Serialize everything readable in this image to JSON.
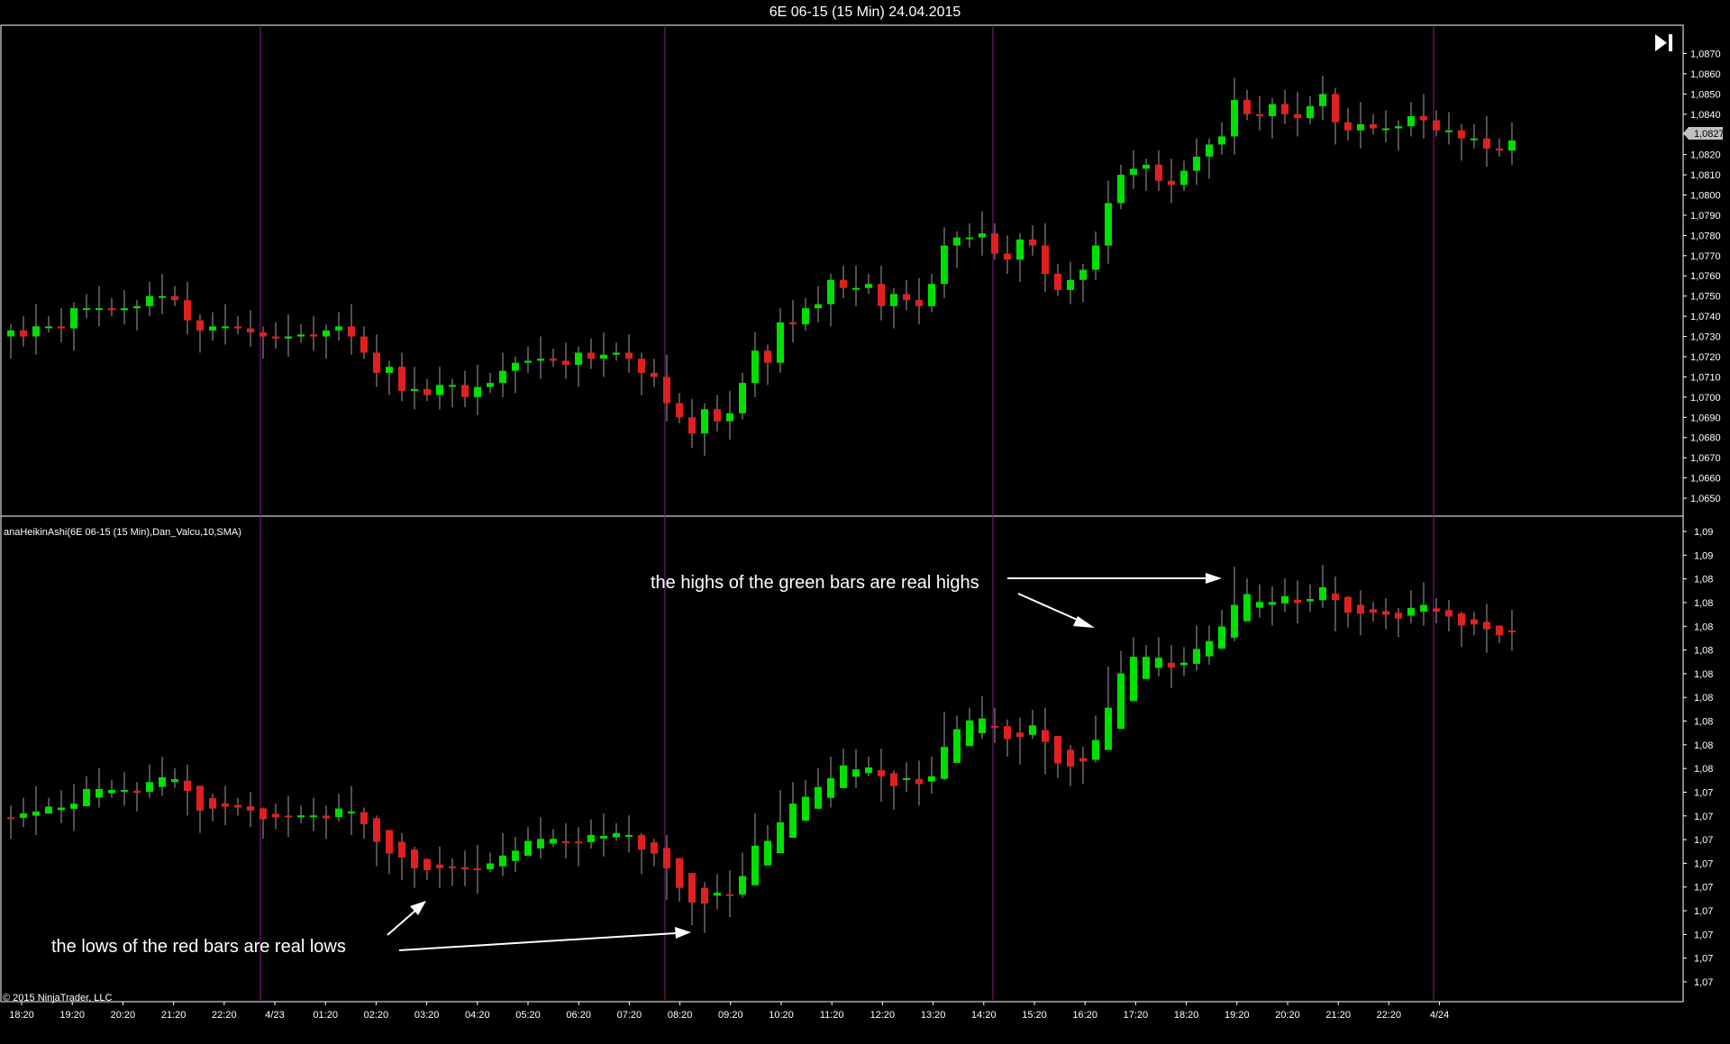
{
  "window": {
    "title": "6E 06-15 (15 Min)  24.04.2015"
  },
  "indicator_label": "anaHeikinAshi(6E 06-15 (15 Min),Dan_Valcu,10,SMA)",
  "copyright": "© 2015 NinjaTrader, LLC",
  "price_marker": "1,0827",
  "annotations": {
    "highs": "the highs of the green bars are real highs",
    "lows": "the lows of the red bars are real lows"
  },
  "colors": {
    "up": "#00e000",
    "down": "#e02020",
    "wick": "#a0a0a0",
    "session_line": "#8b1a8b",
    "background": "#000000",
    "frame": "#ffffff"
  },
  "chart_data": [
    {
      "type": "candlestick",
      "panel": "price",
      "y_ticks": [
        "1,0870",
        "1,0860",
        "1,0850",
        "1,0840",
        "1,0830",
        "1,0820",
        "1,0810",
        "1,0800",
        "1,0790",
        "1,0780",
        "1,0770",
        "1,0760",
        "1,0750",
        "1,0740",
        "1,0730",
        "1,0720",
        "1,0710",
        "1,0700",
        "1,0690",
        "1,0680",
        "1,0670",
        "1,0660",
        "1,0650"
      ],
      "ylim": [
        1.0646,
        1.0876
      ],
      "bar_count": 120,
      "path": [
        1.0733,
        1.073,
        1.0735,
        1.0735,
        1.0734,
        1.0744,
        1.0744,
        1.0744,
        1.0743,
        1.0744,
        1.0745,
        1.075,
        1.075,
        1.0748,
        1.0738,
        1.0733,
        1.0735,
        1.0735,
        1.0734,
        1.0732,
        1.073,
        1.0729,
        1.073,
        1.0731,
        1.073,
        1.0733,
        1.0735,
        1.073,
        1.0722,
        1.0712,
        1.0715,
        1.0703,
        1.0704,
        1.0701,
        1.0706,
        1.0706,
        1.07,
        1.0705,
        1.0707,
        1.0713,
        1.0717,
        1.0718,
        1.0719,
        1.0718,
        1.0716,
        1.0722,
        1.0719,
        1.0721,
        1.0722,
        1.0719,
        1.0712,
        1.071,
        1.0697,
        1.069,
        1.0682,
        1.0694,
        1.0688,
        1.0692,
        1.0707,
        1.0723,
        1.0717,
        1.0737,
        1.0736,
        1.0744,
        1.0746,
        1.0758,
        1.0754,
        1.0754,
        1.0756,
        1.0745,
        1.0751,
        1.0748,
        1.0745,
        1.0756,
        1.0775,
        1.0779,
        1.0779,
        1.0781,
        1.0771,
        1.0768,
        1.0778,
        1.0775,
        1.0761,
        1.0753,
        1.0758,
        1.0763,
        1.0775,
        1.0796,
        1.081,
        1.0813,
        1.0815,
        1.0807,
        1.0805,
        1.0812,
        1.0819,
        1.0825,
        1.0829,
        1.0847,
        1.084,
        1.0839,
        1.0845,
        1.084,
        1.0838,
        1.0844,
        1.085,
        1.0836,
        1.0832,
        1.0835,
        1.0833,
        1.0833,
        1.0834,
        1.0839,
        1.0837,
        1.0832,
        1.0832,
        1.0828,
        1.0828,
        1.0823,
        1.0822,
        1.0827
      ]
    },
    {
      "type": "candlestick",
      "panel": "heikin-ashi",
      "y_ticks": [
        "1,09",
        "1,09",
        "1,08",
        "1,08",
        "1,08",
        "1,08",
        "1,08",
        "1,08",
        "1,08",
        "1,08",
        "1,08",
        "1,07",
        "1,07",
        "1,07",
        "1,07",
        "1,07",
        "1,07",
        "1,07",
        "1,07",
        "1,07"
      ],
      "ylim": [
        1.0646,
        1.0876
      ]
    }
  ],
  "x_axis": {
    "labels": [
      "18:20",
      "19:20",
      "20:20",
      "21:20",
      "22:20",
      "4/23",
      "01:20",
      "02:20",
      "03:20",
      "04:20",
      "05:20",
      "06:20",
      "07:20",
      "08:20",
      "09:20",
      "10:20",
      "11:20",
      "12:20",
      "13:20",
      "14:20",
      "15:20",
      "16:20",
      "17:20",
      "18:20",
      "19:20",
      "20:20",
      "21:20",
      "22:20",
      "4/24"
    ]
  }
}
